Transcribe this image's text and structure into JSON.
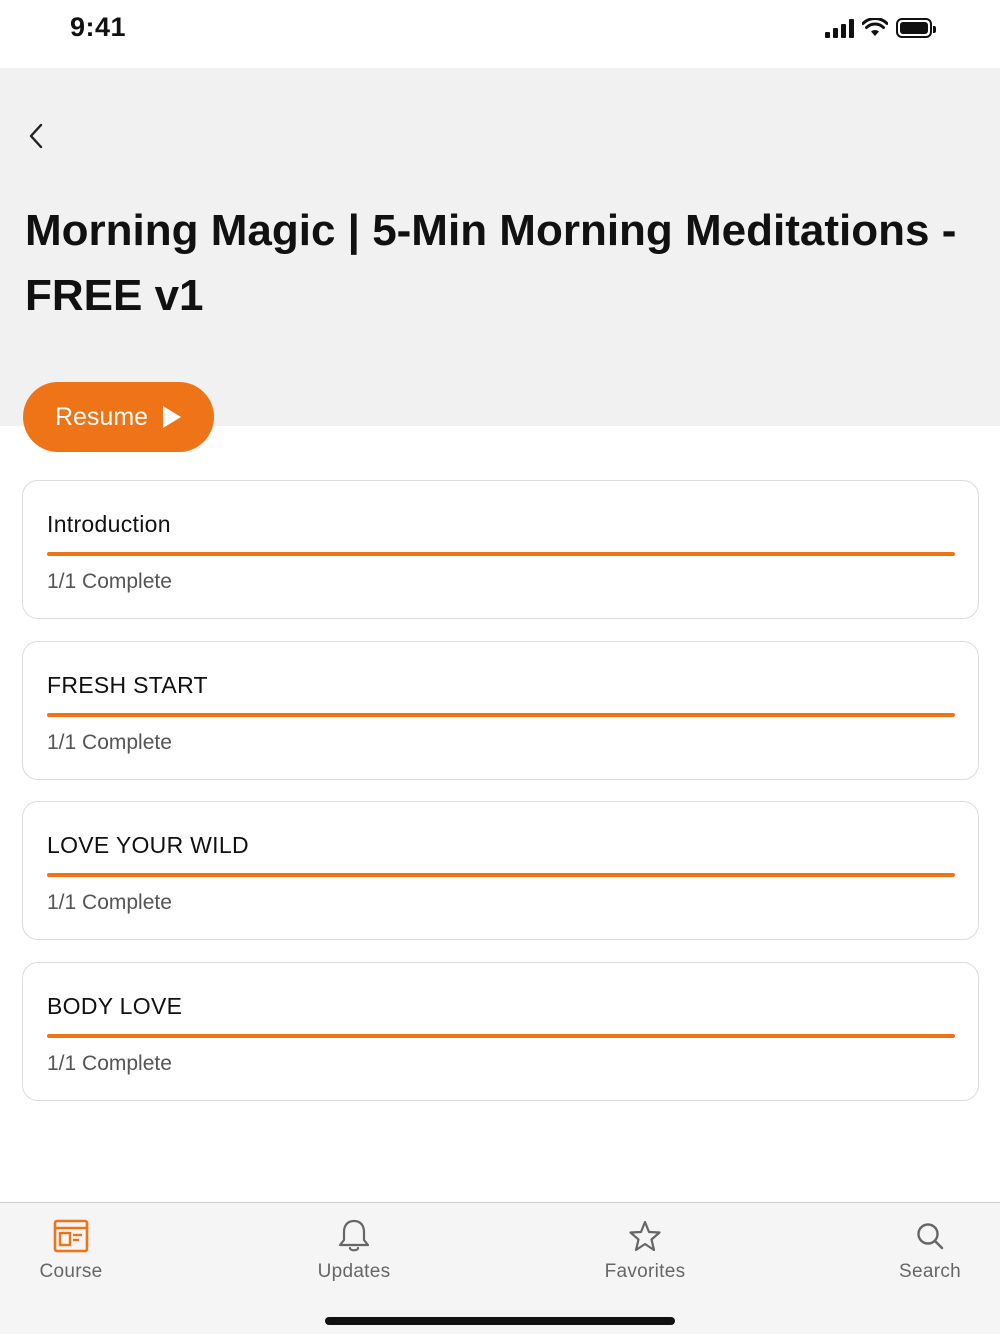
{
  "status_bar": {
    "time": "9:41",
    "icons": [
      "signal-icon",
      "wifi-icon",
      "battery-icon"
    ]
  },
  "header": {
    "back_icon": "chevron-left-icon",
    "title": "Morning Magic | 5-Min Morning Meditations - FREE v1",
    "resume_label": "Resume",
    "resume_icon": "play-icon"
  },
  "colors": {
    "accent": "#ef7418",
    "header_bg": "#f1f1f1",
    "card_border": "#dcdcdc"
  },
  "sections": [
    {
      "title": "Introduction",
      "status": "1/1 Complete",
      "progress": 1.0
    },
    {
      "title": "FRESH START",
      "status": "1/1 Complete",
      "progress": 1.0
    },
    {
      "title": "LOVE YOUR WILD",
      "status": "1/1 Complete",
      "progress": 1.0
    },
    {
      "title": "BODY LOVE",
      "status": "1/1 Complete",
      "progress": 1.0
    }
  ],
  "tab_bar": {
    "tabs": [
      {
        "label": "Course",
        "icon": "course-icon",
        "active": true
      },
      {
        "label": "Updates",
        "icon": "bell-icon",
        "active": false
      },
      {
        "label": "Favorites",
        "icon": "star-icon",
        "active": false
      },
      {
        "label": "Search",
        "icon": "search-icon",
        "active": false
      }
    ]
  }
}
